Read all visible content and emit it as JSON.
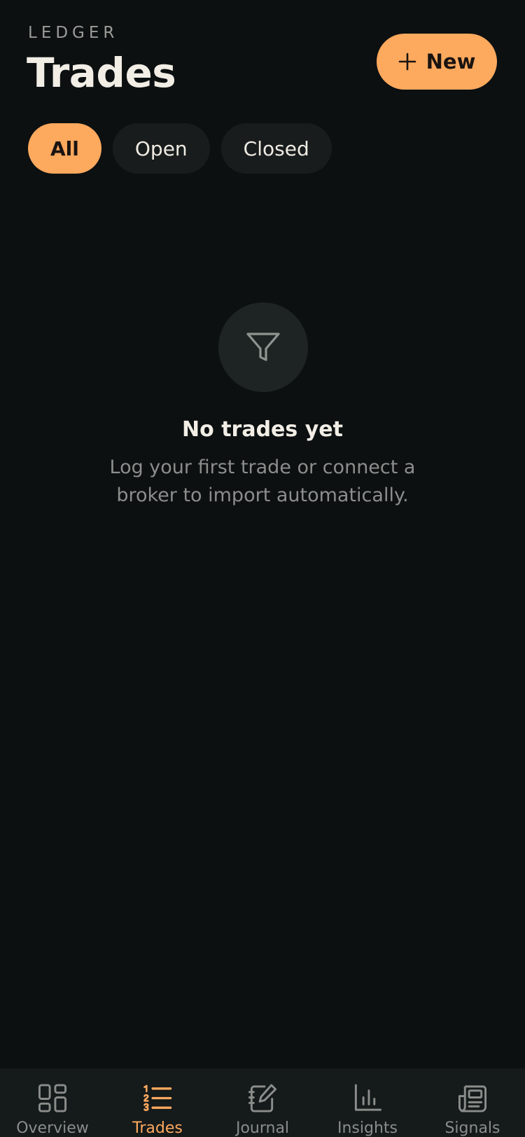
{
  "header": {
    "eyebrow": "LEDGER",
    "title": "Trades",
    "new_button_label": "New"
  },
  "filters": [
    {
      "label": "All",
      "active": true
    },
    {
      "label": "Open",
      "active": false
    },
    {
      "label": "Closed",
      "active": false
    }
  ],
  "empty_state": {
    "icon": "filter-icon",
    "title": "No trades yet",
    "line1": "Log your first trade or connect a",
    "line2": "broker to import automatically."
  },
  "tabbar": {
    "items": [
      {
        "label": "Overview",
        "icon": "grid-icon",
        "active": false
      },
      {
        "label": "Trades",
        "icon": "list-icon",
        "active": true
      },
      {
        "label": "Journal",
        "icon": "notebook-pen-icon",
        "active": false
      },
      {
        "label": "Insights",
        "icon": "bar-chart-icon",
        "active": false
      },
      {
        "label": "Signals",
        "icon": "newspaper-icon",
        "active": false
      }
    ]
  },
  "colors": {
    "background": "#0c1011",
    "accent": "#fda95e",
    "chip_inactive": "#181c1d",
    "tabbar": "#151a1b"
  }
}
